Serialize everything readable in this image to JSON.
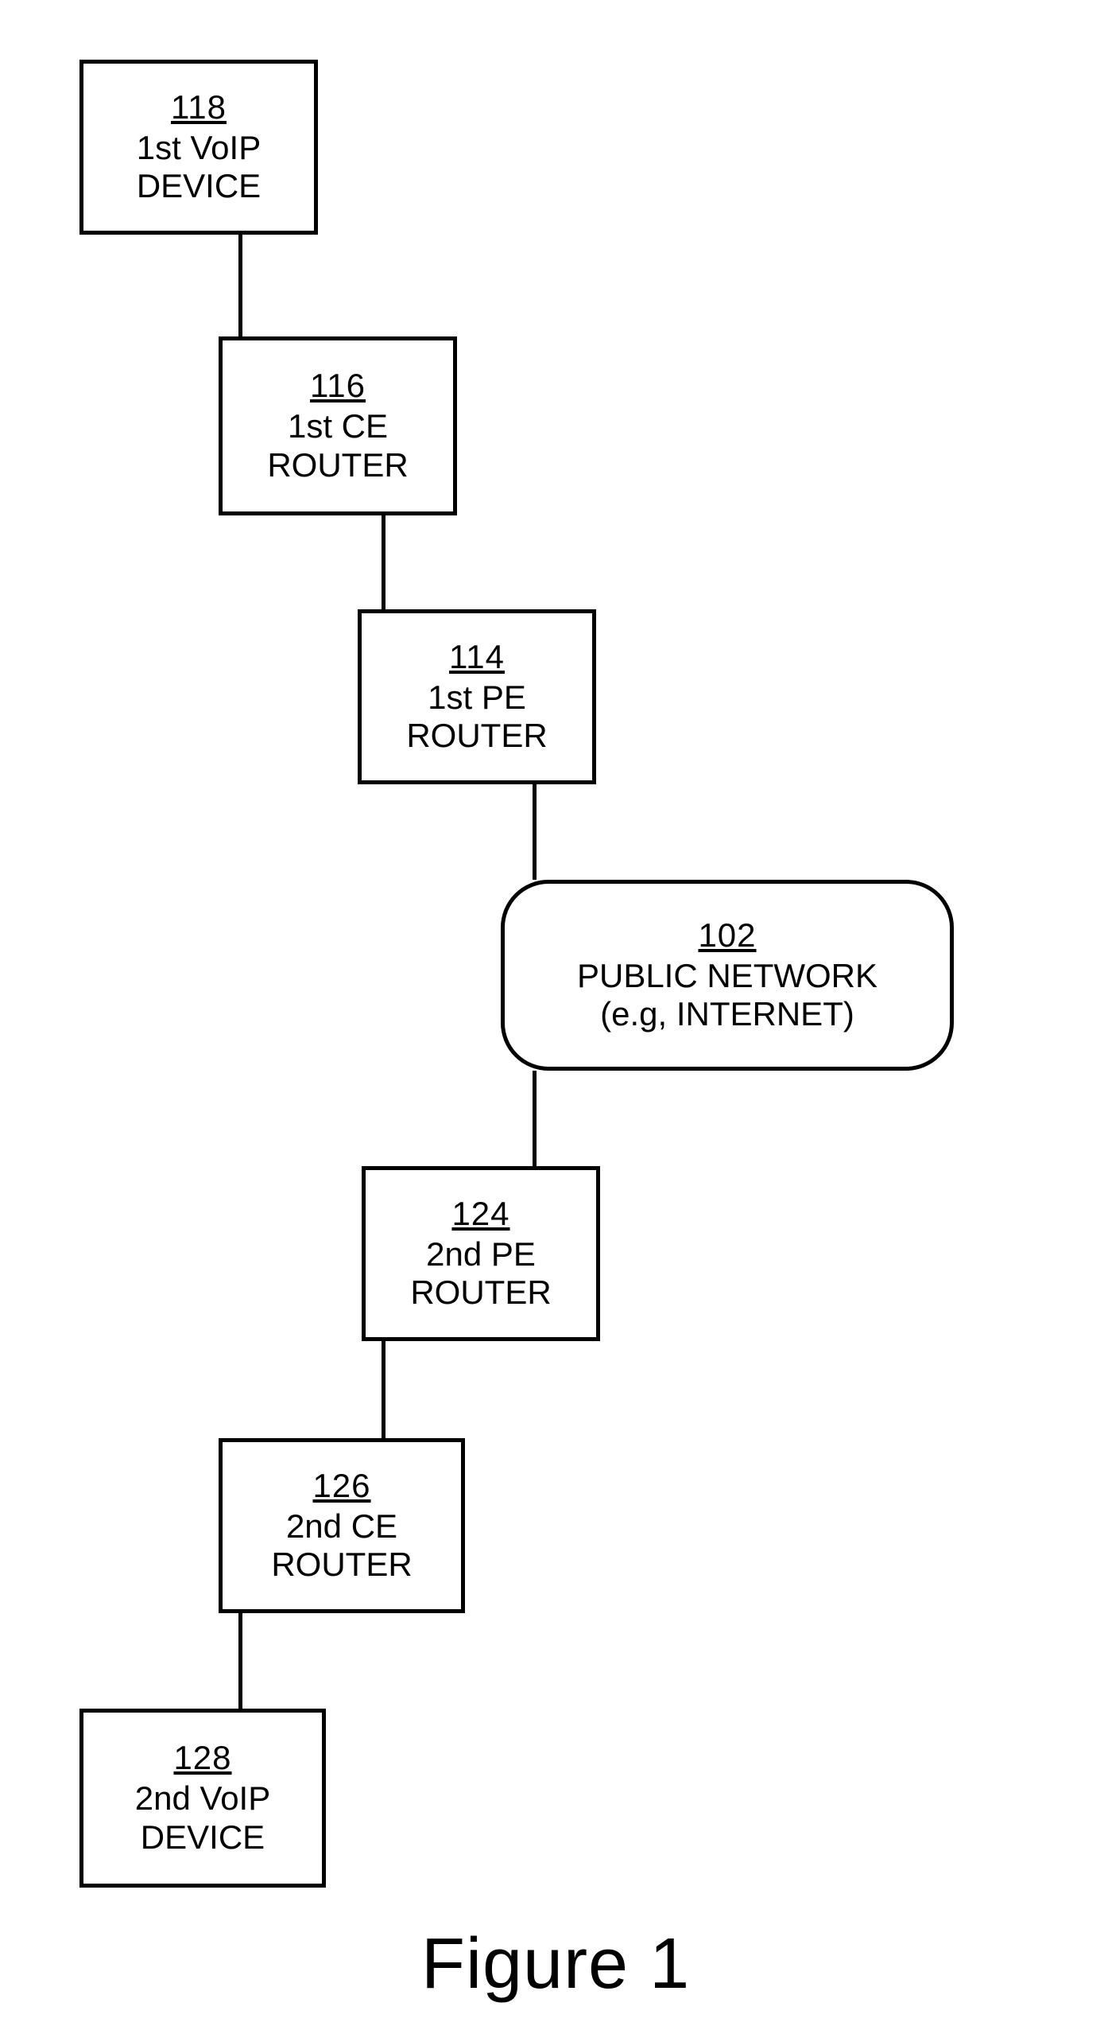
{
  "nodes": {
    "n118": {
      "ref": "118",
      "label": "1st VoIP\nDEVICE"
    },
    "n116": {
      "ref": "116",
      "label": "1st CE\nROUTER"
    },
    "n114": {
      "ref": "114",
      "label": "1st PE\nROUTER"
    },
    "n102": {
      "ref": "102",
      "label": "PUBLIC NETWORK\n(e.g, INTERNET)"
    },
    "n124": {
      "ref": "124",
      "label": "2nd PE\nROUTER"
    },
    "n126": {
      "ref": "126",
      "label": "2nd CE\nROUTER"
    },
    "n128": {
      "ref": "128",
      "label": "2nd VoIP\nDEVICE"
    }
  },
  "caption": "Figure 1",
  "chart_data": {
    "type": "diagram",
    "title": "Figure 1",
    "nodes": [
      {
        "id": "118",
        "label": "1st VoIP DEVICE",
        "shape": "rect"
      },
      {
        "id": "116",
        "label": "1st CE ROUTER",
        "shape": "rect"
      },
      {
        "id": "114",
        "label": "1st PE ROUTER",
        "shape": "rect"
      },
      {
        "id": "102",
        "label": "PUBLIC NETWORK (e.g, INTERNET)",
        "shape": "rounded-rect"
      },
      {
        "id": "124",
        "label": "2nd PE ROUTER",
        "shape": "rect"
      },
      {
        "id": "126",
        "label": "2nd CE ROUTER",
        "shape": "rect"
      },
      {
        "id": "128",
        "label": "2nd VoIP DEVICE",
        "shape": "rect"
      }
    ],
    "edges": [
      {
        "from": "118",
        "to": "116"
      },
      {
        "from": "116",
        "to": "114"
      },
      {
        "from": "114",
        "to": "102"
      },
      {
        "from": "102",
        "to": "124"
      },
      {
        "from": "124",
        "to": "126"
      },
      {
        "from": "126",
        "to": "128"
      }
    ]
  }
}
